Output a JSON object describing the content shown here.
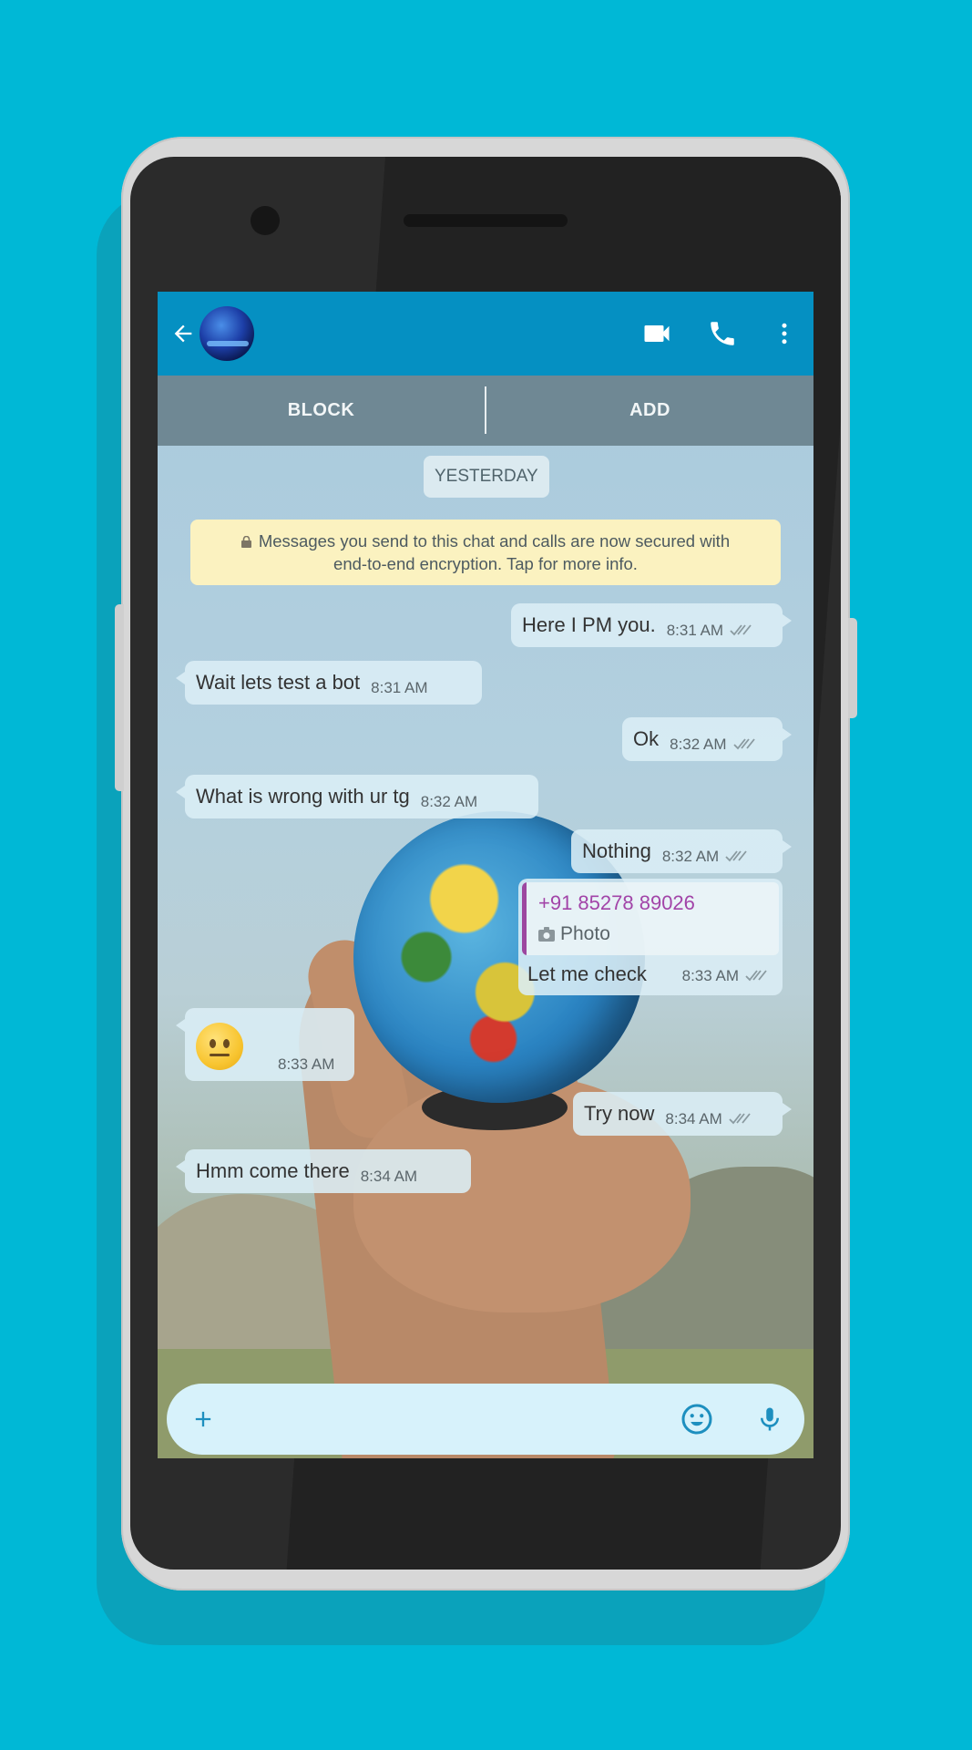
{
  "header": {
    "back": "back-arrow",
    "actions": [
      "video-call-icon",
      "voice-call-icon",
      "more-vert-icon"
    ]
  },
  "action_bar": {
    "block_label": "BLOCK",
    "add_label": "ADD"
  },
  "chat": {
    "date_chip": "YESTERDAY",
    "encryption_line1": "Messages you send to this chat and calls are now secured with",
    "encryption_line2": "end-to-end encryption. Tap for more info.",
    "messages": [
      {
        "dir": "out",
        "text": "Here I PM you.",
        "time": "8:31 AM"
      },
      {
        "dir": "in",
        "text": "Wait lets test a bot",
        "time": "8:31 AM"
      },
      {
        "dir": "out",
        "text": "Ok",
        "time": "8:32 AM"
      },
      {
        "dir": "in",
        "text": "What is wrong with ur tg",
        "time": "8:32 AM"
      },
      {
        "dir": "out",
        "text": "Nothing",
        "time": "8:32 AM"
      },
      {
        "dir": "out",
        "quoted_name": "+91 85278 89026",
        "quoted_content": "Photo",
        "text": "Let me check",
        "time": "8:33 AM"
      },
      {
        "dir": "in",
        "emoji": "neutral-face",
        "time": "8:33 AM"
      },
      {
        "dir": "out",
        "text": "Try now",
        "time": "8:34 AM"
      },
      {
        "dir": "in",
        "text": "Hmm come there",
        "time": "8:34 AM"
      }
    ]
  },
  "input": {
    "value": "",
    "placeholder": ""
  },
  "colors": {
    "background": "#00b8d6",
    "app_bar": "#0590c2",
    "action_bar": "#6f8894",
    "encryption_bg": "#fbf2c0",
    "quote_accent": "#9c47a0",
    "input_bg": "#d7f2fb"
  }
}
